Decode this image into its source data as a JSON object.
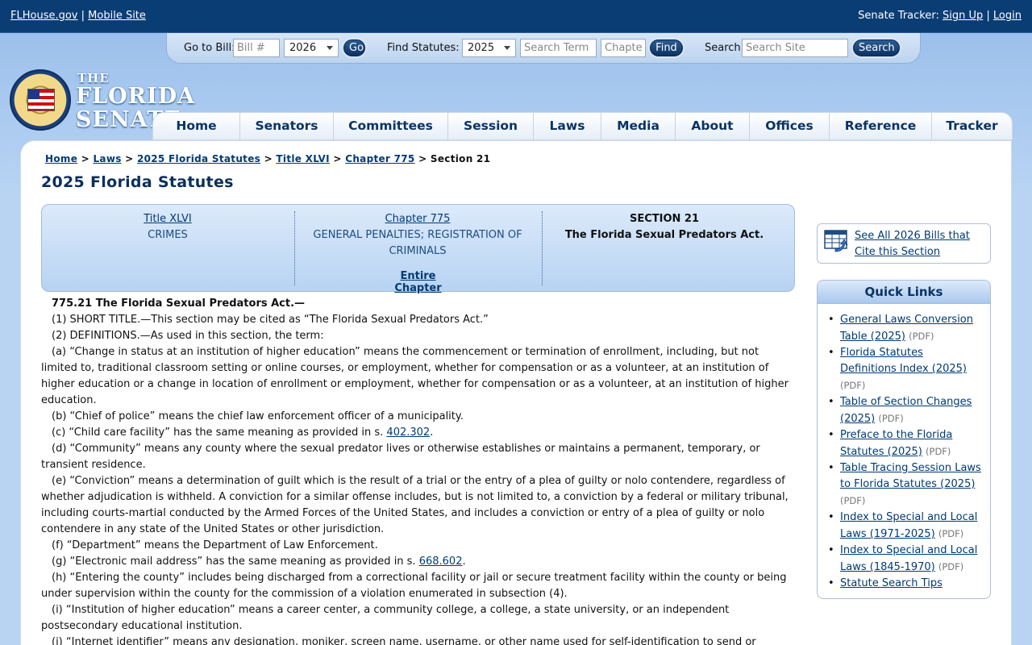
{
  "topbar": {
    "flhouse": "FLHouse.gov",
    "sep": "|",
    "mobile": "Mobile Site",
    "tracker_label": "Senate Tracker:",
    "signup": "Sign Up",
    "login": "Login"
  },
  "search": {
    "goto_label": "Go to Bill:",
    "bill_placeholder": "Bill #",
    "bill_year": "2026",
    "go": "Go",
    "find_label": "Find Statutes:",
    "statute_year": "2025",
    "term_placeholder": "Search Term",
    "chapter_placeholder": "Chapter",
    "find": "Find",
    "site_label": "Search",
    "site_placeholder": "Search Site",
    "site_btn": "Search"
  },
  "logo": {
    "the": "THE",
    "line1": "FLORIDA",
    "line2": "SENATE"
  },
  "nav": [
    "Home",
    "Senators",
    "Committees",
    "Session",
    "Laws",
    "Media",
    "About",
    "Offices",
    "Reference",
    "Tracker"
  ],
  "breadcrumb": {
    "home": "Home",
    "laws": "Laws",
    "statutes": "2025 Florida Statutes",
    "title": "Title XLVI",
    "chapter": "Chapter 775",
    "current": "Section 21",
    "sep": ">"
  },
  "page_title": "2025 Florida Statutes",
  "navbox": {
    "title_link": "Title XLVI",
    "title_name": "CRIMES",
    "chapter_link": "Chapter 775",
    "chapter_name": "GENERAL PENALTIES; REGISTRATION OF CRIMINALS",
    "entire": "Entire Chapter",
    "section": "SECTION 21",
    "section_name": "The Florida Sexual Predators Act."
  },
  "statute": {
    "heading": "775.21   The Florida Sexual Predators Act.—",
    "p1": "(1)   SHORT TITLE.—This section may be cited as “The Florida Sexual Predators Act.”",
    "p2": "(2)   DEFINITIONS.—As used in this section, the term:",
    "a": "(a)   “Change in status at an institution of higher education” means the commencement or termination of enrollment, including, but not limited to, traditional classroom setting or online courses, or employment, whether for compensation or as a volunteer, at an institution of higher education or a change in location of enrollment or employment, whether for compensation or as a volunteer, at an institution of higher education.",
    "b": "(b)   “Chief of police” means the chief law enforcement officer of a municipality.",
    "c_pre": "(c)   “Child care facility” has the same meaning as provided in s. ",
    "c_link": "402.302",
    "c_post": ".",
    "d": "(d)   “Community” means any county where the sexual predator lives or otherwise establishes or maintains a permanent, temporary, or transient residence.",
    "e": "(e)   “Conviction” means a determination of guilt which is the result of a trial or the entry of a plea of guilty or nolo contendere, regardless of whether adjudication is withheld. A conviction for a similar offense includes, but is not limited to, a conviction by a federal or military tribunal, including courts-martial conducted by the Armed Forces of the United States, and includes a conviction or entry of a plea of guilty or nolo contendere in any state of the United States or other jurisdiction.",
    "f": "(f)   “Department” means the Department of Law Enforcement.",
    "g_pre": "(g)   “Electronic mail address” has the same meaning as provided in s. ",
    "g_link": "668.602",
    "g_post": ".",
    "h": "(h)   “Entering the county” includes being discharged from a correctional facility or jail or secure treatment facility within the county or being under supervision within the county for the commission of a violation enumerated in subsection (4).",
    "i": "(i)   “Institution of higher education” means a career center, a community college, a college, a state university, or an independent postsecondary educational institution.",
    "j": "(j)   “Internet identifier” means any designation, moniker, screen name, username, or other name used for self-identification to send or"
  },
  "sidebar": {
    "cite": "See All 2026 Bills that Cite this Section",
    "quick_title": "Quick Links",
    "links": [
      {
        "text": "General Laws Conversion Table (2025)",
        "pdf": "(PDF)"
      },
      {
        "text": "Florida Statutes Definitions Index (2025)",
        "pdf": "(PDF)"
      },
      {
        "text": "Table of Section Changes (2025)",
        "pdf": "(PDF)"
      },
      {
        "text": "Preface to the Florida Statutes (2025)",
        "pdf": "(PDF)"
      },
      {
        "text": "Table Tracing Session Laws to Florida Statutes (2025)",
        "pdf": "(PDF)"
      },
      {
        "text": "Index to Special and Local Laws (1971-2025)",
        "pdf": "(PDF)"
      },
      {
        "text": "Index to Special and Local Laws (1845-1970)",
        "pdf": "(PDF)"
      },
      {
        "text": "Statute Search Tips",
        "pdf": ""
      }
    ]
  },
  "colors": {
    "navy": "#0b3d75",
    "sky": "#a9c8ee",
    "link": "#003a75"
  }
}
